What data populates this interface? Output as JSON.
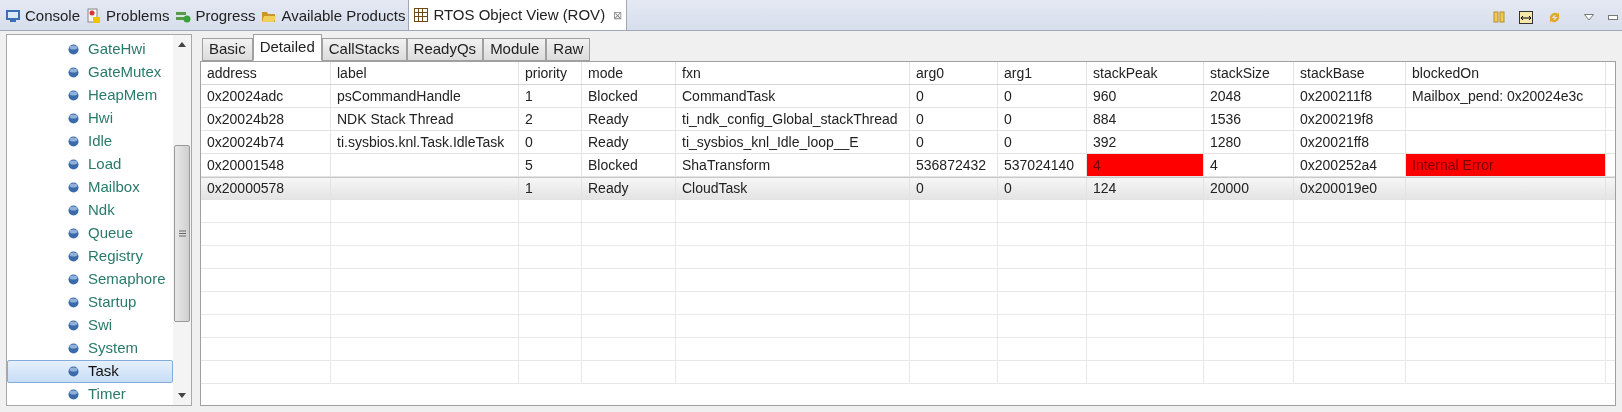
{
  "view_tabs": [
    {
      "label": "Console",
      "selected": false
    },
    {
      "label": "Problems",
      "selected": false
    },
    {
      "label": "Progress",
      "selected": false
    },
    {
      "label": "Available Products",
      "selected": false
    },
    {
      "label": "RTOS Object View (ROV)",
      "selected": true,
      "close": "⊠"
    }
  ],
  "sidebar": {
    "items": [
      {
        "label": "GateHwi",
        "selected": false
      },
      {
        "label": "GateMutex",
        "selected": false
      },
      {
        "label": "HeapMem",
        "selected": false
      },
      {
        "label": "Hwi",
        "selected": false
      },
      {
        "label": "Idle",
        "selected": false
      },
      {
        "label": "Load",
        "selected": false
      },
      {
        "label": "Mailbox",
        "selected": false
      },
      {
        "label": "Ndk",
        "selected": false
      },
      {
        "label": "Queue",
        "selected": false
      },
      {
        "label": "Registry",
        "selected": false
      },
      {
        "label": "Semaphore",
        "selected": false
      },
      {
        "label": "Startup",
        "selected": false
      },
      {
        "label": "Swi",
        "selected": false
      },
      {
        "label": "System",
        "selected": false
      },
      {
        "label": "Task",
        "selected": true
      },
      {
        "label": "Timer",
        "selected": false
      }
    ]
  },
  "tabs": [
    {
      "label": "Basic",
      "selected": false
    },
    {
      "label": "Detailed",
      "selected": true
    },
    {
      "label": "CallStacks",
      "selected": false
    },
    {
      "label": "ReadyQs",
      "selected": false
    },
    {
      "label": "Module",
      "selected": false
    },
    {
      "label": "Raw",
      "selected": false
    }
  ],
  "table": {
    "columns": [
      "address",
      "label",
      "priority",
      "mode",
      "fxn",
      "arg0",
      "arg1",
      "stackPeak",
      "stackSize",
      "stackBase",
      "blockedOn"
    ],
    "rows": [
      {
        "cells": {
          "address": "0x20024adc",
          "label": "psCommandHandle",
          "priority": "1",
          "mode": "Blocked",
          "fxn": "CommandTask",
          "arg0": "0",
          "arg1": "0",
          "stackPeak": "960",
          "stackSize": "2048",
          "stackBase": "0x200211f8",
          "blockedOn": "Mailbox_pend: 0x20024e3c"
        },
        "selected": false
      },
      {
        "cells": {
          "address": "0x20024b28",
          "label": "NDK Stack Thread",
          "priority": "2",
          "mode": "Ready",
          "fxn": "ti_ndk_config_Global_stackThread",
          "arg0": "0",
          "arg1": "0",
          "stackPeak": "884",
          "stackSize": "1536",
          "stackBase": "0x200219f8"
        },
        "selected": false
      },
      {
        "cells": {
          "address": "0x20024b74",
          "label": "ti.sysbios.knl.Task.IdleTask",
          "priority": "0",
          "mode": "Ready",
          "fxn": "ti_sysbios_knl_Idle_loop__E",
          "arg0": "0",
          "arg1": "0",
          "stackPeak": "392",
          "stackSize": "1280",
          "stackBase": "0x20021ff8"
        },
        "selected": false
      },
      {
        "cells": {
          "address": "0x20001548",
          "priority": "5",
          "mode": "Blocked",
          "fxn": "ShaTransform",
          "arg0": "536872432",
          "arg1": "537024140",
          "stackPeak": "4",
          "stackSize": "4",
          "stackBase": "0x200252a4",
          "blockedOn": "Internal Error"
        },
        "error": {
          "stackPeak": true,
          "blockedOn": true
        },
        "selected": false
      },
      {
        "cells": {
          "address": "0x20000578",
          "priority": "1",
          "mode": "Ready",
          "fxn": "CloudTask",
          "arg0": "0",
          "arg1": "0",
          "stackPeak": "124",
          "stackSize": "20000",
          "stackBase": "0x200019e0"
        },
        "selected": true
      }
    ]
  }
}
